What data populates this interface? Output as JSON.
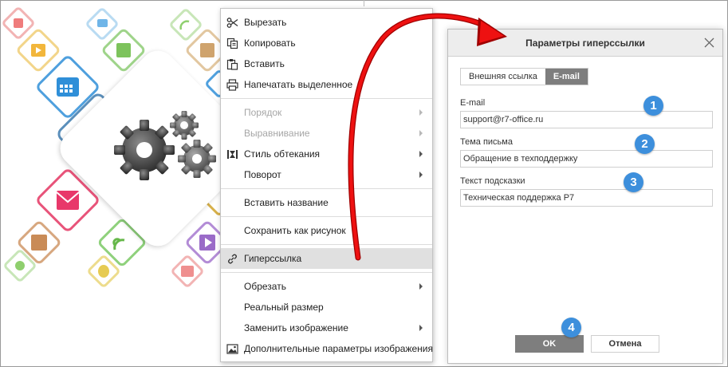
{
  "context_menu": {
    "items": [
      {
        "label": "Вырезать",
        "icon": "scissors-icon",
        "enabled": true,
        "submenu": false
      },
      {
        "label": "Копировать",
        "icon": "copy-icon",
        "enabled": true,
        "submenu": false
      },
      {
        "label": "Вставить",
        "icon": "paste-icon",
        "enabled": true,
        "submenu": false
      },
      {
        "label": "Напечатать выделенное",
        "icon": "printer-icon",
        "enabled": true,
        "submenu": false
      },
      {
        "label": "Порядок",
        "enabled": false,
        "submenu": true
      },
      {
        "label": "Выравнивание",
        "enabled": false,
        "submenu": true
      },
      {
        "label": "Стиль обтекания",
        "icon": "text-wrap-icon",
        "enabled": true,
        "submenu": true
      },
      {
        "label": "Поворот",
        "enabled": true,
        "submenu": true
      },
      {
        "label": "Вставить название",
        "enabled": true,
        "submenu": false
      },
      {
        "label": "Сохранить как рисунок",
        "enabled": true,
        "submenu": false
      },
      {
        "label": "Гиперссылка",
        "icon": "link-icon",
        "enabled": true,
        "submenu": false,
        "highlighted": true
      },
      {
        "label": "Обрезать",
        "enabled": true,
        "submenu": true
      },
      {
        "label": "Реальный размер",
        "enabled": true,
        "submenu": false
      },
      {
        "label": "Заменить изображение",
        "enabled": true,
        "submenu": true
      },
      {
        "label": "Дополнительные параметры изображения",
        "icon": "image-settings-icon",
        "enabled": true,
        "submenu": false
      }
    ]
  },
  "dialog": {
    "title": "Параметры гиперссылки",
    "tabs": [
      {
        "label": "Внешняя ссылка",
        "selected": false
      },
      {
        "label": "E-mail",
        "selected": true
      }
    ],
    "fields": {
      "email": {
        "label": "E-mail",
        "value": "support@r7-office.ru"
      },
      "subject": {
        "label": "Тема письма",
        "value": "Обращение в техподдержку"
      },
      "tooltip": {
        "label": "Текст подсказки",
        "value": "Техническая поддержка Р7"
      }
    },
    "ok_label": "OK",
    "cancel_label": "Отмена"
  },
  "badges": [
    "1",
    "2",
    "3",
    "4"
  ],
  "colors": {
    "accent_badge": "#3d8fdc",
    "arrow": "#e00000",
    "button_dark": "#7e7e7e"
  }
}
